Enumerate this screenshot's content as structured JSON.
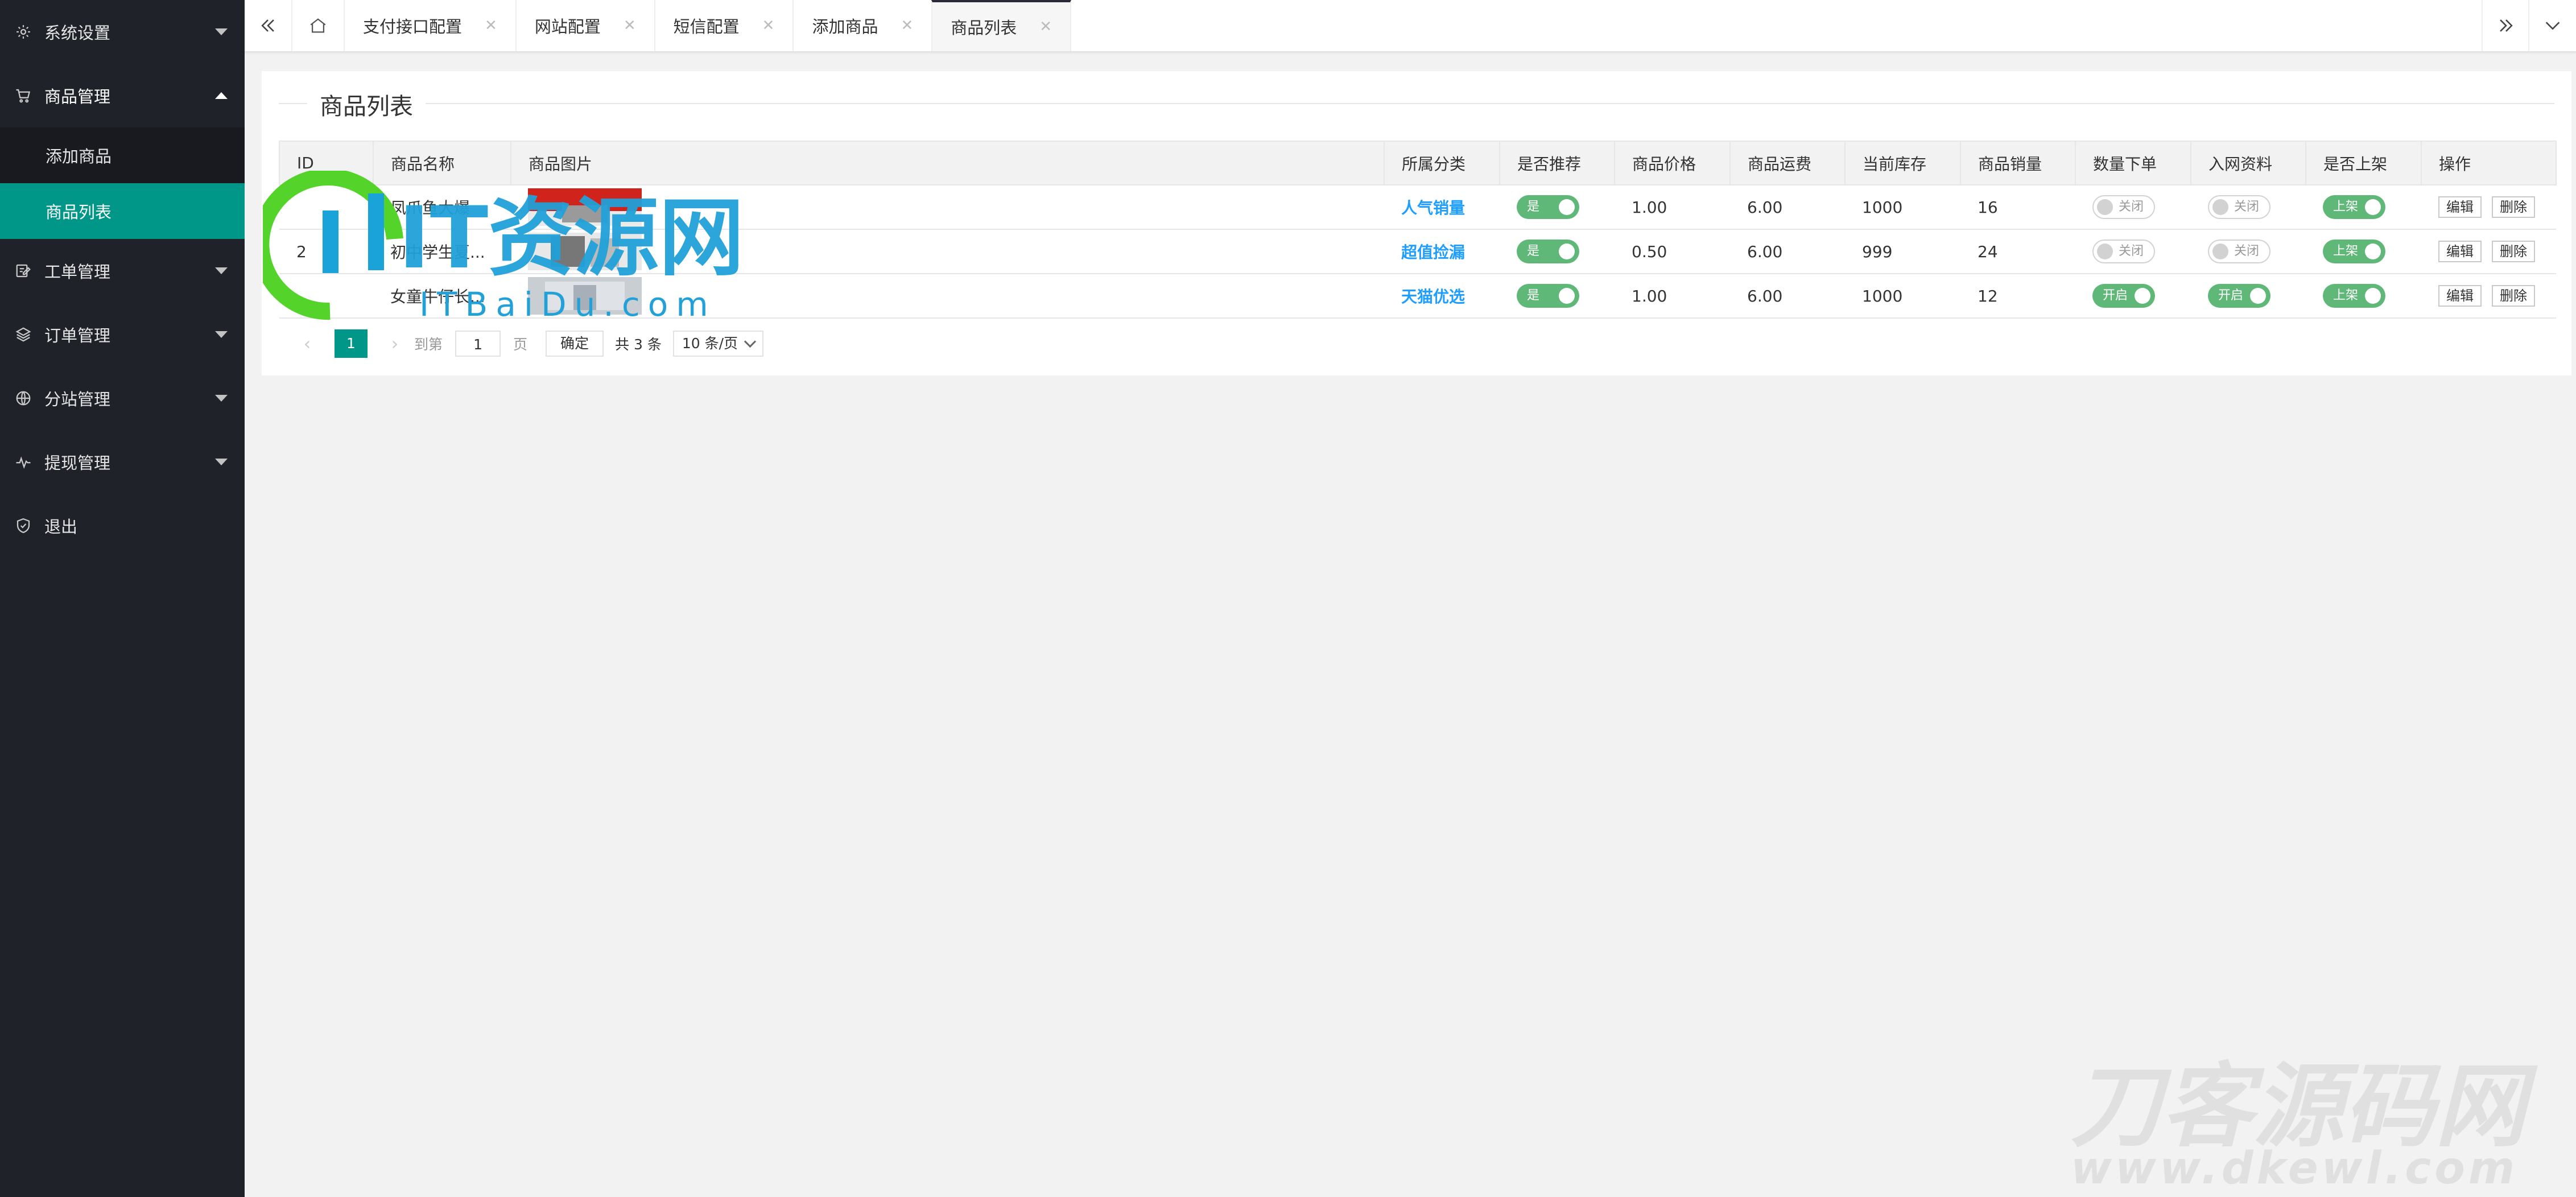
{
  "sidebar": {
    "items": [
      {
        "label": "系统设置",
        "icon": "gear-icon"
      },
      {
        "label": "商品管理",
        "icon": "cart-icon"
      },
      {
        "label": "工单管理",
        "icon": "edit-icon"
      },
      {
        "label": "订单管理",
        "icon": "layers-icon"
      },
      {
        "label": "分站管理",
        "icon": "globe-icon"
      },
      {
        "label": "提现管理",
        "icon": "pulse-icon"
      },
      {
        "label": "退出",
        "icon": "shield-icon"
      }
    ],
    "submenu": [
      "添加商品",
      "商品列表"
    ],
    "active_submenu": "商品列表"
  },
  "tabs": {
    "items": [
      "支付接口配置",
      "网站配置",
      "短信配置",
      "添加商品",
      "商品列表"
    ],
    "active": "商品列表"
  },
  "page": {
    "title": "商品列表"
  },
  "table": {
    "columns": [
      "ID",
      "商品名称",
      "商品图片",
      "所属分类",
      "是否推荐",
      "商品价格",
      "商品运费",
      "当前库存",
      "商品销量",
      "数量下单",
      "入网资料",
      "是否上架",
      "操作"
    ],
    "rows": [
      {
        "id": "",
        "name": "凤爪鱼大爆",
        "category": "人气销量",
        "recommend": "是",
        "price": "1.00",
        "shipping": "6.00",
        "stock": "1000",
        "sales": "16",
        "qty_order": "关闭",
        "qty_on": false,
        "net_info": "关闭",
        "net_on": false,
        "listed": "上架"
      },
      {
        "id": "2",
        "name": "初中学生夏...",
        "category": "超值捡漏",
        "recommend": "是",
        "price": "0.50",
        "shipping": "6.00",
        "stock": "999",
        "sales": "24",
        "qty_order": "关闭",
        "qty_on": false,
        "net_info": "关闭",
        "net_on": false,
        "listed": "上架"
      },
      {
        "id": "",
        "name": "女童牛仔长...",
        "category": "天猫优选",
        "recommend": "是",
        "price": "1.00",
        "shipping": "6.00",
        "stock": "1000",
        "sales": "12",
        "qty_order": "开启",
        "qty_on": true,
        "net_info": "开启",
        "net_on": true,
        "listed": "上架"
      }
    ],
    "actions": {
      "edit": "编辑",
      "delete": "删除"
    }
  },
  "pagination": {
    "current": "1",
    "goto_prefix": "到第",
    "goto_value": "1",
    "goto_suffix": "页",
    "confirm": "确定",
    "total": "共 3 条",
    "page_size": "10 条/页"
  },
  "watermarks": {
    "top_text": "IT资源网",
    "top_sub": "ITBaiDu.com",
    "bottom_text": "刀客源码网",
    "bottom_sub": "www.dkewl.com"
  },
  "colors": {
    "sidebar_bg": "#20222a",
    "accent": "#009688",
    "switch_on": "#5fb878",
    "category": "#1e9fff",
    "price": "#ff5722",
    "stock": "#cc0000"
  }
}
